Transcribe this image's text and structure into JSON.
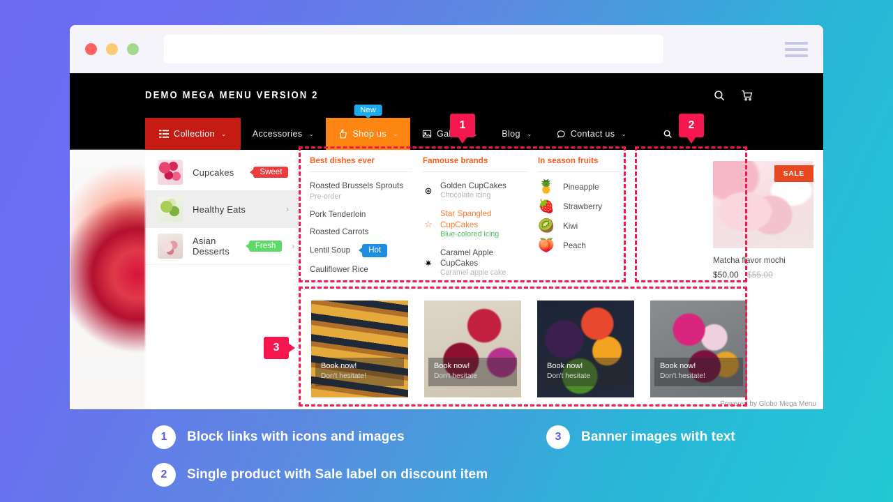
{
  "browser": {
    "dots": [
      "close-red",
      "minimize-yellow",
      "maximize-green"
    ],
    "url_value": "",
    "url_placeholder": "",
    "menu_icon": "hamburger-icon"
  },
  "site": {
    "logo": "DEMO MEGA MENU VERSION 2",
    "header_icons": [
      "search-icon",
      "cart-icon"
    ]
  },
  "nav": {
    "items": [
      {
        "label": "Collection",
        "icon": "list-icon",
        "caret": "⌄",
        "style": "collection"
      },
      {
        "label": "Accessories",
        "icon": "",
        "caret": "⌄",
        "style": "plain"
      },
      {
        "label": "Shop us",
        "icon": "thumbs-up-icon",
        "caret": "⌄",
        "style": "shop",
        "badge": "New"
      },
      {
        "label": "Gallery",
        "icon": "image-icon",
        "caret": "⌄",
        "style": "plain"
      },
      {
        "label": "Blog",
        "icon": "",
        "caret": "⌄",
        "style": "plain"
      },
      {
        "label": "Contact us",
        "icon": "chat-icon",
        "caret": "⌄",
        "style": "plain"
      }
    ],
    "search_icon": "search-icon"
  },
  "sidebar": {
    "items": [
      {
        "label": "Cupcakes",
        "tag": "Sweet",
        "tag_color": "#ee3b3b",
        "thumb": "cupcakes",
        "active": false
      },
      {
        "label": "Healthy Eats",
        "tag": "",
        "tag_color": "",
        "thumb": "healthy",
        "active": true
      },
      {
        "label": "Asian Desserts",
        "tag": "Fresh",
        "tag_color": "#5ed96a",
        "thumb": "asian",
        "active": false
      }
    ],
    "chevron": "›"
  },
  "columns": [
    {
      "title": "Best dishes ever",
      "links": [
        {
          "label": "Roasted Brussels Sprouts",
          "sub": "Pre-order",
          "tag": ""
        },
        {
          "label": "Pork Tenderloin",
          "sub": "",
          "tag": ""
        },
        {
          "label": "Roasted Carrots",
          "sub": "",
          "tag": ""
        },
        {
          "label": "Lentil Soup",
          "sub": "",
          "tag": "Hot"
        },
        {
          "label": "Cauliflower Rice",
          "sub": "",
          "tag": ""
        }
      ]
    },
    {
      "title": "Famouse brands",
      "brands": [
        {
          "icon": "⊛",
          "icon_name": "sun-burst-icon",
          "line1": "Golden CupCakes",
          "sub": "Chocolate icing",
          "highlight": false
        },
        {
          "icon": "☆",
          "icon_name": "star-outline-icon",
          "line1": "Star Spangled",
          "line2": "CupCakes",
          "sub": "Blue-colored icing",
          "highlight": true
        },
        {
          "icon": "✷",
          "icon_name": "asterisk-icon",
          "line1": "Caramel Apple",
          "line2": "CupCakes",
          "sub": "Caramel apple cake",
          "highlight": false
        }
      ]
    },
    {
      "title": "In season fruits",
      "fruits": [
        {
          "emoji": "🍍",
          "name": "Pineapple"
        },
        {
          "emoji": "🍓",
          "name": "Strawberry"
        },
        {
          "emoji": "🥝",
          "name": "Kiwi"
        },
        {
          "emoji": "🍑",
          "name": "Peach"
        }
      ]
    }
  ],
  "product": {
    "sale_label": "SALE",
    "name": "Matcha flavor mochi",
    "price": "$50.00",
    "old_price": "$55.00"
  },
  "banners": [
    {
      "title": "Book now!",
      "subtitle": "Don't hesitate!",
      "art": "b1"
    },
    {
      "title": "Book now!",
      "subtitle": "Don't hesitate",
      "art": "b2"
    },
    {
      "title": "Book now!",
      "subtitle": "Don't hesitate",
      "art": "b3"
    },
    {
      "title": "Book now!",
      "subtitle": "Don't hesitate!",
      "art": "b4"
    }
  ],
  "footer": {
    "powered_by": "Powered by Globo Mega Menu"
  },
  "markers": {
    "one": "1",
    "two": "2",
    "three": "3"
  },
  "legend": {
    "items": [
      {
        "num": "1",
        "text": "Block links with icons and images"
      },
      {
        "num": "2",
        "text": "Single product with Sale label on discount item"
      },
      {
        "num": "3",
        "text": "Banner images with text"
      }
    ]
  },
  "colors": {
    "accent_pink": "#f5174e",
    "orange": "#ff5a1f",
    "nav_red": "#c41b13",
    "nav_orange": "#fd8512",
    "badge_blue": "#1eaaef",
    "sale_red": "#e8481f",
    "bg_start": "#6b6cf0",
    "bg_end": "#22c8d4"
  }
}
